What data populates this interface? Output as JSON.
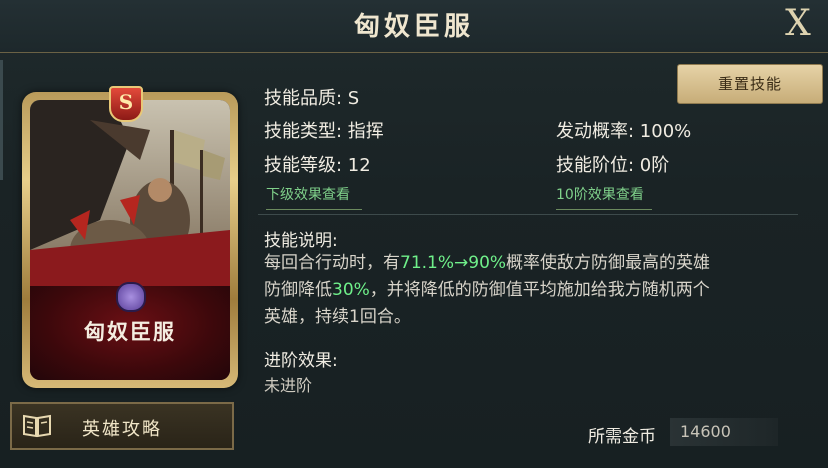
{
  "window": {
    "title": "匈奴臣服",
    "close_label": "X"
  },
  "card": {
    "name": "匈奴臣服",
    "quality_badge": "S"
  },
  "guide_button": {
    "label": "英雄攻略"
  },
  "reset_button": {
    "label": "重置技能"
  },
  "skill": {
    "quality_label": "技能品质: ",
    "quality_value": "S",
    "type_label": "技能类型: ",
    "type_value": "指挥",
    "level_label": "技能等级: ",
    "level_value": "12",
    "trigger_label": "发动概率: ",
    "trigger_value": "100%",
    "rank_label": "技能阶位: ",
    "rank_value": "0阶",
    "next_level_link": "下级效果查看",
    "rank10_link": "10阶效果查看",
    "desc_title": "技能说明:",
    "desc_part1": "每回合行动时，有",
    "desc_hl1": "71.1%→90%",
    "desc_part2": "概率使敌方防御最高的英雄",
    "desc_part3": "防御降低",
    "desc_hl2": "30%",
    "desc_part4": "，并将降低的防御值平均施加给我方随机两个",
    "desc_part5": "英雄，持续1回合。",
    "advance_title": "进阶效果:",
    "advance_value": "未进阶"
  },
  "cost": {
    "label": "所需金币",
    "value": "14600"
  },
  "icons": [
    "close-icon",
    "book-icon",
    "quality-badge-icon",
    "troop-type-icon"
  ],
  "colors": {
    "highlight": "#6ff08a",
    "link": "#7fd08a",
    "card_red": "#6a0f14",
    "gold_frame": "#e7cf8a"
  }
}
